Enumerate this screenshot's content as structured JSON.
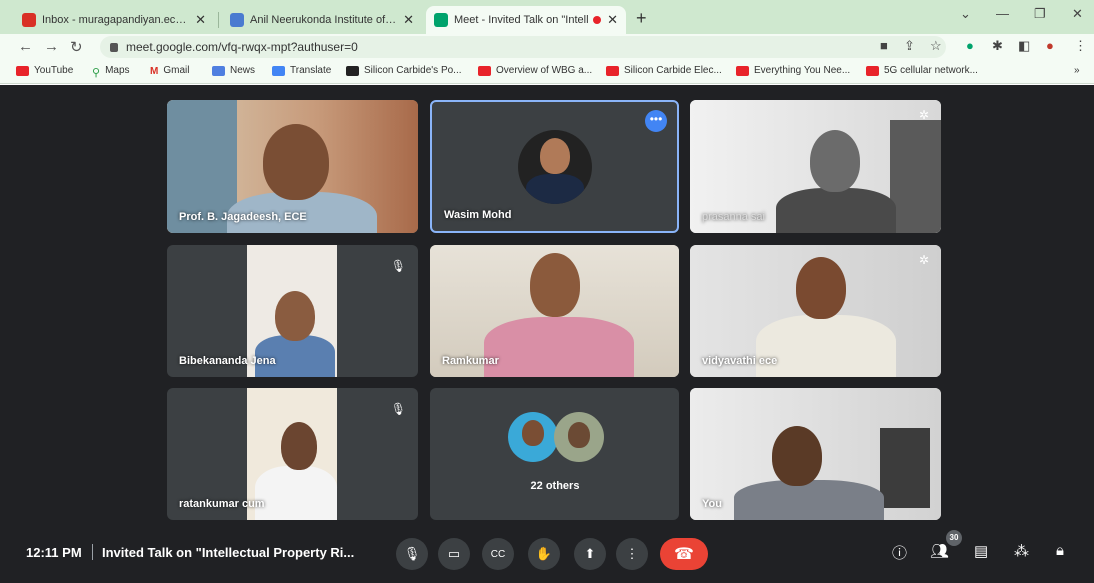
{
  "browser": {
    "tabs": [
      {
        "label": "Inbox - muragapandiyan.ece@...",
        "favicon_color": "#d93025"
      },
      {
        "label": "Anil Neerukonda Institute of Tec",
        "favicon_color": "#4a7bd0"
      },
      {
        "label": "Meet - Invited Talk on \"Intell",
        "favicon_color": "#00a36c",
        "active": true
      }
    ],
    "new_tab_icon": "plus-icon",
    "url": "meet.google.com/vfq-rwqx-mpt?authuser=0",
    "bookmarks": [
      "YouTube",
      "Maps",
      "Gmail",
      "News",
      "Translate",
      "Silicon Carbide's Po...",
      "Overview of WBG a...",
      "Silicon Carbide Elec...",
      "Everything You Nee...",
      "5G cellular network..."
    ]
  },
  "meeting": {
    "participants": [
      {
        "name": "Prof. B. Jagadeesh, ECE",
        "muted": false
      },
      {
        "name": "Wasim Mohd",
        "muted": false,
        "speaking": true
      },
      {
        "name": "prasanna sai",
        "muted": false
      },
      {
        "name": "Bibekananda Jena",
        "muted": true
      },
      {
        "name": "Ramkumar",
        "muted": false
      },
      {
        "name": "vidyavathi ece",
        "muted": false
      },
      {
        "name": "ratankumar cum",
        "muted": true
      },
      {
        "name": "22 others",
        "muted": false
      },
      {
        "name": "You",
        "muted": false
      }
    ],
    "time": "12:11 PM",
    "title": "Invited Talk on \"Intellectual Property Ri...",
    "participants_count": "30",
    "accent": "#8ab4f8",
    "hangup_color": "#ea4335"
  }
}
